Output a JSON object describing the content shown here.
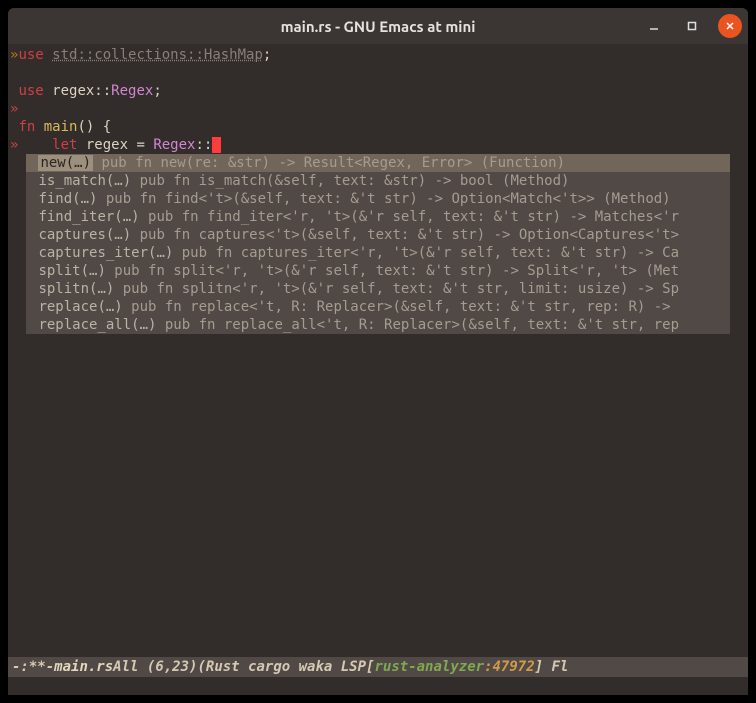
{
  "window": {
    "title": "main.rs - GNU Emacs at mini"
  },
  "code": {
    "line1_kw": "use",
    "line1_path": "std::collections::HashMap",
    "line1_end": ";",
    "line3_kw": "use",
    "line3_ident": " regex::",
    "line3_type": "Regex",
    "line3_end": ";",
    "line5_kw": "fn",
    "line5_fn": " main",
    "line5_rest": "() {",
    "line6_indent": "    ",
    "line6_kw": "let",
    "line6_var": " regex ",
    "line6_eq": "= ",
    "line6_type": "Regex",
    "line6_cc": "::"
  },
  "completions": [
    {
      "name": "new(…)",
      "sig": " pub fn new(re: &str) -> Result<Regex, Error> (Function)"
    },
    {
      "name": "is_match(…)",
      "sig": " pub fn is_match(&self, text: &str) -> bool (Method)"
    },
    {
      "name": "find(…)",
      "sig": " pub fn find<'t>(&self, text: &'t str) -> Option<Match<'t>> (Method)"
    },
    {
      "name": "find_iter(…)",
      "sig": " pub fn find_iter<'r, 't>(&'r self, text: &'t str) -> Matches<'r"
    },
    {
      "name": "captures(…)",
      "sig": " pub fn captures<'t>(&self, text: &'t str) -> Option<Captures<'t>"
    },
    {
      "name": "captures_iter(…)",
      "sig": " pub fn captures_iter<'r, 't>(&'r self, text: &'t str) -> Ca"
    },
    {
      "name": "split(…)",
      "sig": " pub fn split<'r, 't>(&'r self, text: &'t str) -> Split<'r, 't> (Met"
    },
    {
      "name": "splitn(…)",
      "sig": " pub fn splitn<'r, 't>(&'r self, text: &'t str, limit: usize) -> Sp"
    },
    {
      "name": "replace(…)",
      "sig": " pub fn replace<'t, R: Replacer>(&self, text: &'t str, rep: R) ->"
    },
    {
      "name": "replace_all(…)",
      "sig": " pub fn replace_all<'t, R: Replacer>(&self, text: &'t str, rep"
    }
  ],
  "modeline": {
    "status": "-:**-",
    "filename": "main.rs",
    "position": "All (6,23)",
    "modes_prefix": "(Rust cargo waka LSP[",
    "lsp_server": "rust-analyzer",
    "lsp_sep": ":",
    "lsp_pid": "47972",
    "modes_suffix": "] Fl"
  }
}
